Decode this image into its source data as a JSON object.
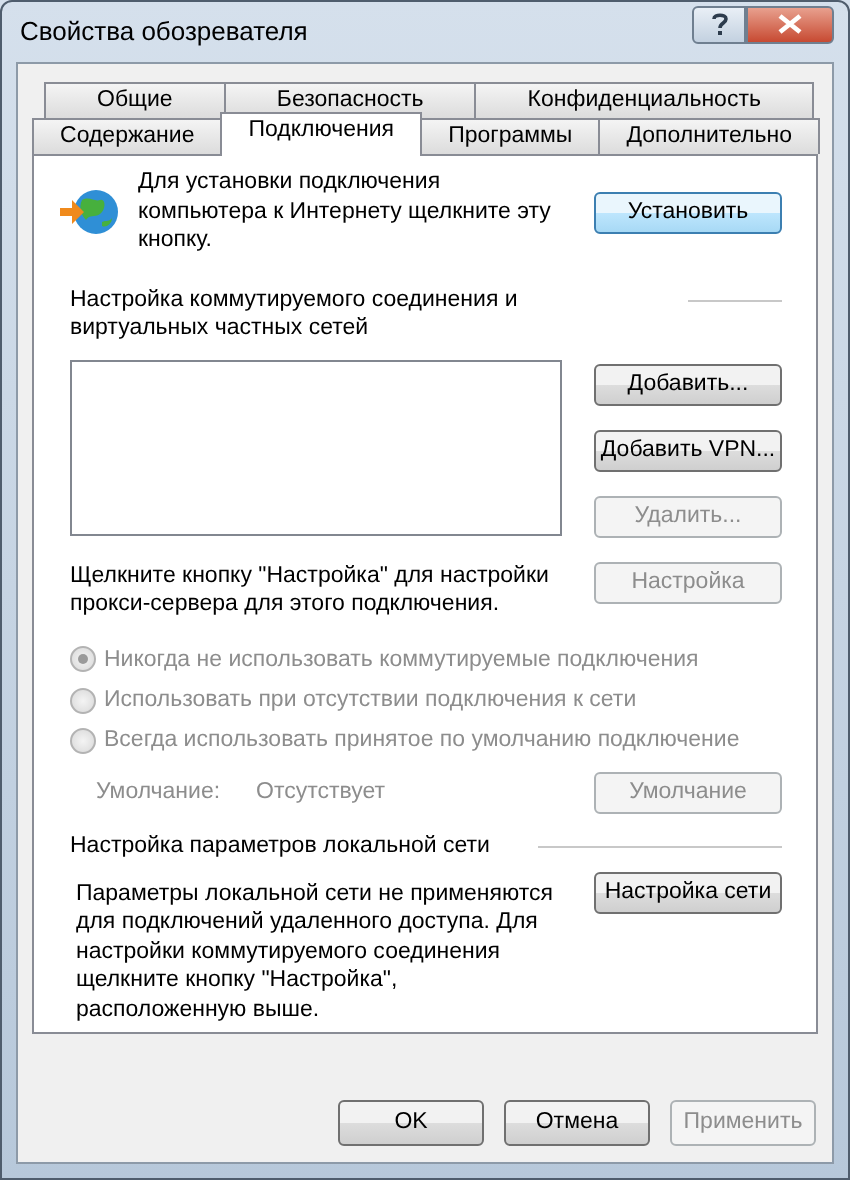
{
  "window": {
    "title": "Свойства обозревателя"
  },
  "tab_rows": [
    [
      {
        "label": "Общие",
        "selected": false
      },
      {
        "label": "Безопасность",
        "selected": false
      },
      {
        "label": "Конфиденциальность",
        "selected": false
      }
    ],
    [
      {
        "label": "Содержание",
        "selected": false
      },
      {
        "label": "Подключения",
        "selected": true
      },
      {
        "label": "Программы",
        "selected": false
      },
      {
        "label": "Дополнительно",
        "selected": false
      }
    ]
  ],
  "setup": {
    "text": "Для установки подключения компьютера к Интернету щелкните эту кнопку.",
    "button": "Установить"
  },
  "dialup": {
    "heading": "Настройка коммутируемого соединения и виртуальных частных сетей",
    "buttons": [
      {
        "label": "Добавить...",
        "disabled": false
      },
      {
        "label": "Добавить VPN...",
        "disabled": false
      },
      {
        "label": "Удалить...",
        "disabled": true
      }
    ],
    "proxy_note": "Щелкните кнопку \"Настройка\" для настройки прокси-сервера для этого подключения.",
    "settings_button": {
      "label": "Настройка",
      "disabled": true
    },
    "options": [
      {
        "label": "Никогда не использовать коммутируемые подключения",
        "selected": true,
        "disabled": true
      },
      {
        "label": "Использовать при отсутствии подключения к сети",
        "selected": false,
        "disabled": true
      },
      {
        "label": "Всегда использовать принятое по умолчанию подключение",
        "selected": false,
        "disabled": true
      }
    ],
    "default_label": "Умолчание:",
    "default_value": "Отсутствует",
    "default_button": {
      "label": "Умолчание",
      "disabled": true
    }
  },
  "lan": {
    "heading": "Настройка параметров локальной сети",
    "note": "Параметры локальной сети не применяются для подключений удаленного доступа. Для настройки коммутируемого соединения щелкните кнопку \"Настройка\", расположенную выше.",
    "button": {
      "label": "Настройка сети",
      "disabled": false
    }
  },
  "footer_buttons": [
    {
      "label": "OK",
      "disabled": false
    },
    {
      "label": "Отмена",
      "disabled": false
    },
    {
      "label": "Применить",
      "disabled": true
    }
  ]
}
